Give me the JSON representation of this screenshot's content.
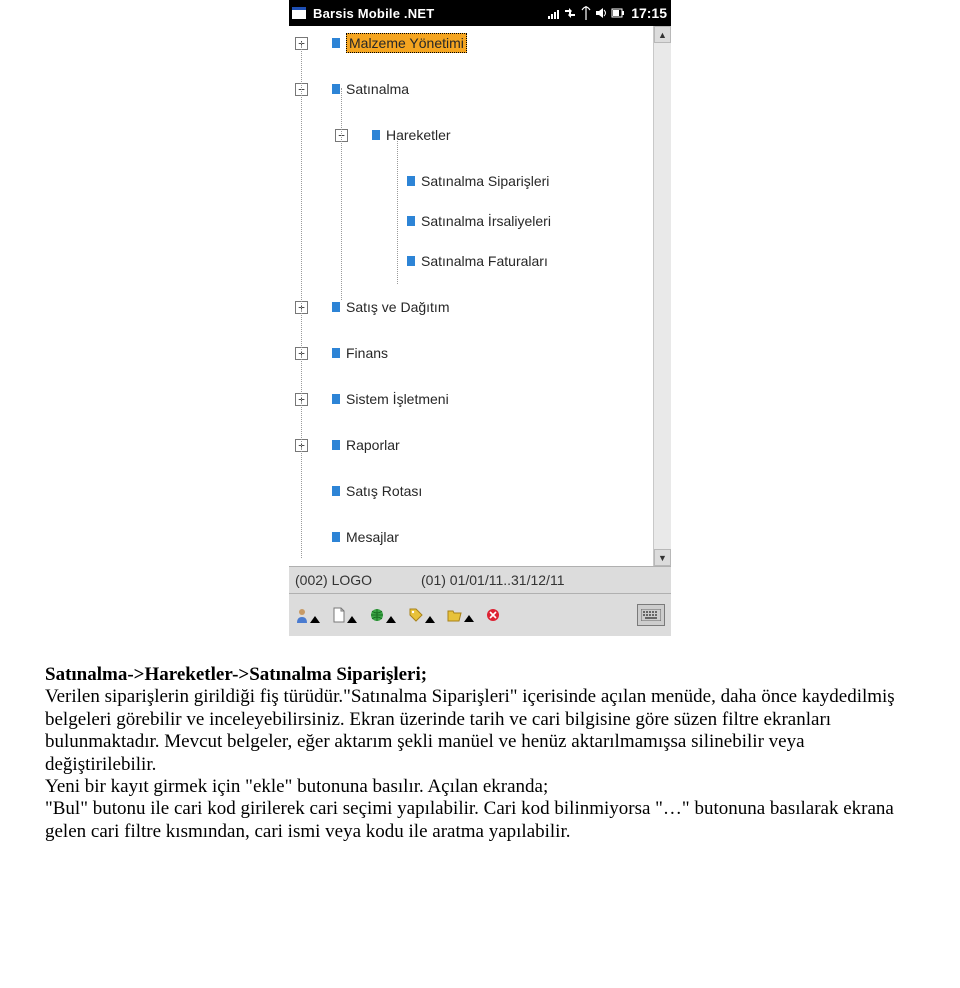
{
  "status": {
    "title": "Barsis Mobile .NET",
    "clock": "17:15"
  },
  "tree": {
    "root": {
      "label": "Malzeme Yönetimi",
      "expander": "+"
    },
    "satinalma": {
      "label": "Satınalma",
      "expander": "−"
    },
    "hareketler": {
      "label": "Hareketler",
      "expander": "−"
    },
    "children": [
      {
        "label": "Satınalma Siparişleri"
      },
      {
        "label": "Satınalma İrsaliyeleri"
      },
      {
        "label": "Satınalma Faturaları"
      }
    ],
    "satis": {
      "label": "Satış ve Dağıtım",
      "expander": "+"
    },
    "finans": {
      "label": "Finans",
      "expander": "+"
    },
    "sistem": {
      "label": "Sistem İşletmeni",
      "expander": "+"
    },
    "raporlar": {
      "label": "Raporlar",
      "expander": "+"
    },
    "rota": {
      "label": "Satış Rotası"
    },
    "mesaj": {
      "label": "Mesajlar"
    }
  },
  "infobar": {
    "col1": "(002) LOGO",
    "col2": "(01) 01/01/11..31/12/11"
  },
  "toolbar": {
    "icons": [
      "user-icon",
      "file-icon",
      "globe-icon",
      "tag-icon",
      "folder-icon",
      "close-red-icon"
    ],
    "right_icon": "keyboard-icon"
  },
  "paragraph": {
    "title": "Satınalma->Hareketler->Satınalma Siparişleri;",
    "t1": "Verilen siparişlerin girildiği fiş türüdür.\"Satınalma Siparişleri\" içerisinde açılan menüde, daha önce kaydedilmiş belgeleri görebilir ve inceleyebilirsiniz. Ekran üzerinde tarih ve cari bilgisine göre süzen filtre ekranları bulunmaktadır. Mevcut belgeler, eğer aktarım şekli manüel ve henüz aktarılmamışsa silinebilir veya değiştirilebilir.",
    "t2": "Yeni bir kayıt girmek için \"ekle\" butonuna basılır. Açılan ekranda;",
    "t3": "\"Bul\" butonu ile cari kod girilerek cari seçimi yapılabilir. Cari kod bilinmiyorsa \"…\" butonuna basılarak ekrana gelen cari filtre kısmından, cari ismi veya kodu ile aratma yapılabilir."
  }
}
